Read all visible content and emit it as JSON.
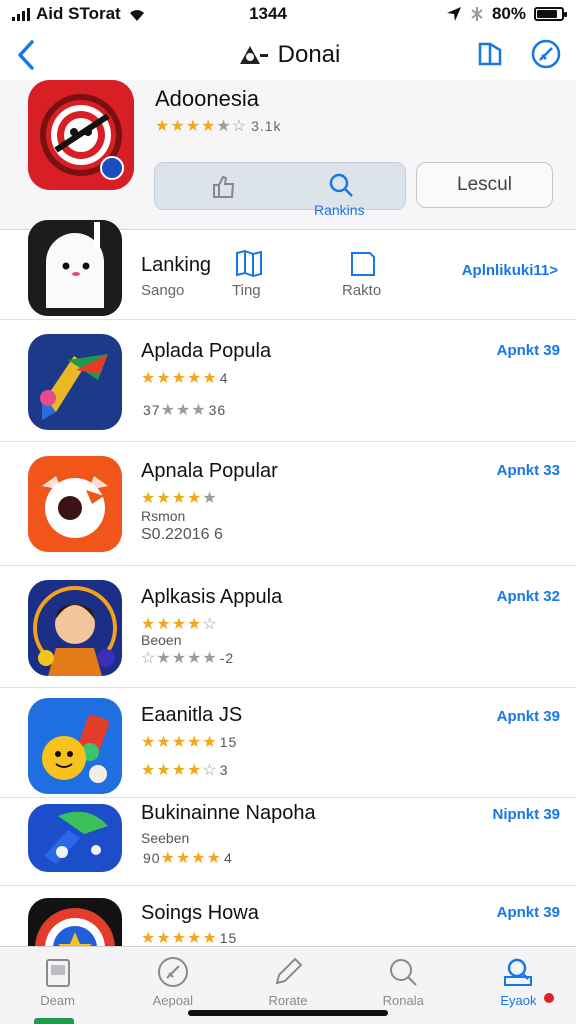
{
  "status": {
    "carrier": "Aid STorat",
    "time": "1344",
    "battery": "80%"
  },
  "nav": {
    "title": "Donai"
  },
  "featured": {
    "name": "Adoonesia",
    "stars_filled": 4,
    "rating_text": "3.1k",
    "segment_label": "Rankins",
    "secondary_button": "Lescul"
  },
  "top_row": {
    "name": "Lanking",
    "subtitle": "Sango",
    "col1": "Ting",
    "col2": "Rakto",
    "price": "Aplnlikuki11>"
  },
  "apps": [
    {
      "name": "Aplada Popula",
      "stars1_filled": 5,
      "stars1_suffix": "4",
      "stars2_prefix": "37",
      "stars2_suffix": "36",
      "line2": "",
      "price": "Apnkt 39"
    },
    {
      "name": "Apnala Popular",
      "stars1_filled": 4,
      "stars1_suffix": "",
      "line2": "Rsmon",
      "line3": "S0.22016 6",
      "price": "Apnkt 33"
    },
    {
      "name": "Aplkasis Appula",
      "stars1_filled": 4,
      "stars1_suffix": "",
      "line2": "Beoen",
      "stars2_suffix": "-2",
      "price": "Apnkt 32"
    },
    {
      "name": "Eaanitla JS",
      "stars1_filled": 5,
      "stars1_suffix": "15",
      "stars2_suffix": "3",
      "price": "Apnkt 39"
    },
    {
      "name": "Bukinainne Napoha",
      "line2": "Seeben",
      "stars2_prefix": "90",
      "stars2_suffix": "4",
      "price": "Nipnkt 39"
    },
    {
      "name": "Soings Howa",
      "stars1_filled": 5,
      "stars1_suffix": "15",
      "price": "Apnkt 39"
    }
  ],
  "tabs": [
    {
      "label": "Deam",
      "icon": "doc-icon"
    },
    {
      "label": "Aepoal",
      "icon": "compass-icon"
    },
    {
      "label": "Rorate",
      "icon": "pencil-icon"
    },
    {
      "label": "Ronala",
      "icon": "search-icon"
    },
    {
      "label": "Eyaok",
      "icon": "search-doc-icon"
    }
  ],
  "colors": {
    "accent": "#1877e6",
    "star": "#f2a81d",
    "badge": "#e02424"
  }
}
